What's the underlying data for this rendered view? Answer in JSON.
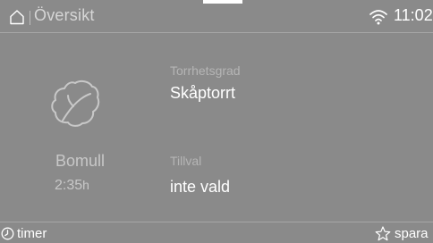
{
  "header": {
    "title": "Översikt",
    "time": "11:02",
    "icons": {
      "home": "home-icon",
      "wifi": "wifi-icon"
    }
  },
  "program": {
    "name": "Bomull",
    "duration": "2:35",
    "duration_unit": "h",
    "icon": "leaf-icon"
  },
  "settings": {
    "dryness_label": "Torrhetsgrad",
    "dryness_value": "Skåptorrt",
    "option_label": "Tillval",
    "option_value": "inte vald"
  },
  "footer": {
    "timer_label": "timer",
    "save_label": "spara",
    "icons": {
      "timer": "timer-icon",
      "save": "star-icon"
    }
  },
  "colors": {
    "background": "#8a8a8a",
    "text": "#ffffff",
    "muted_text": "#b5b5b5",
    "divider": "#a6a6a6"
  }
}
